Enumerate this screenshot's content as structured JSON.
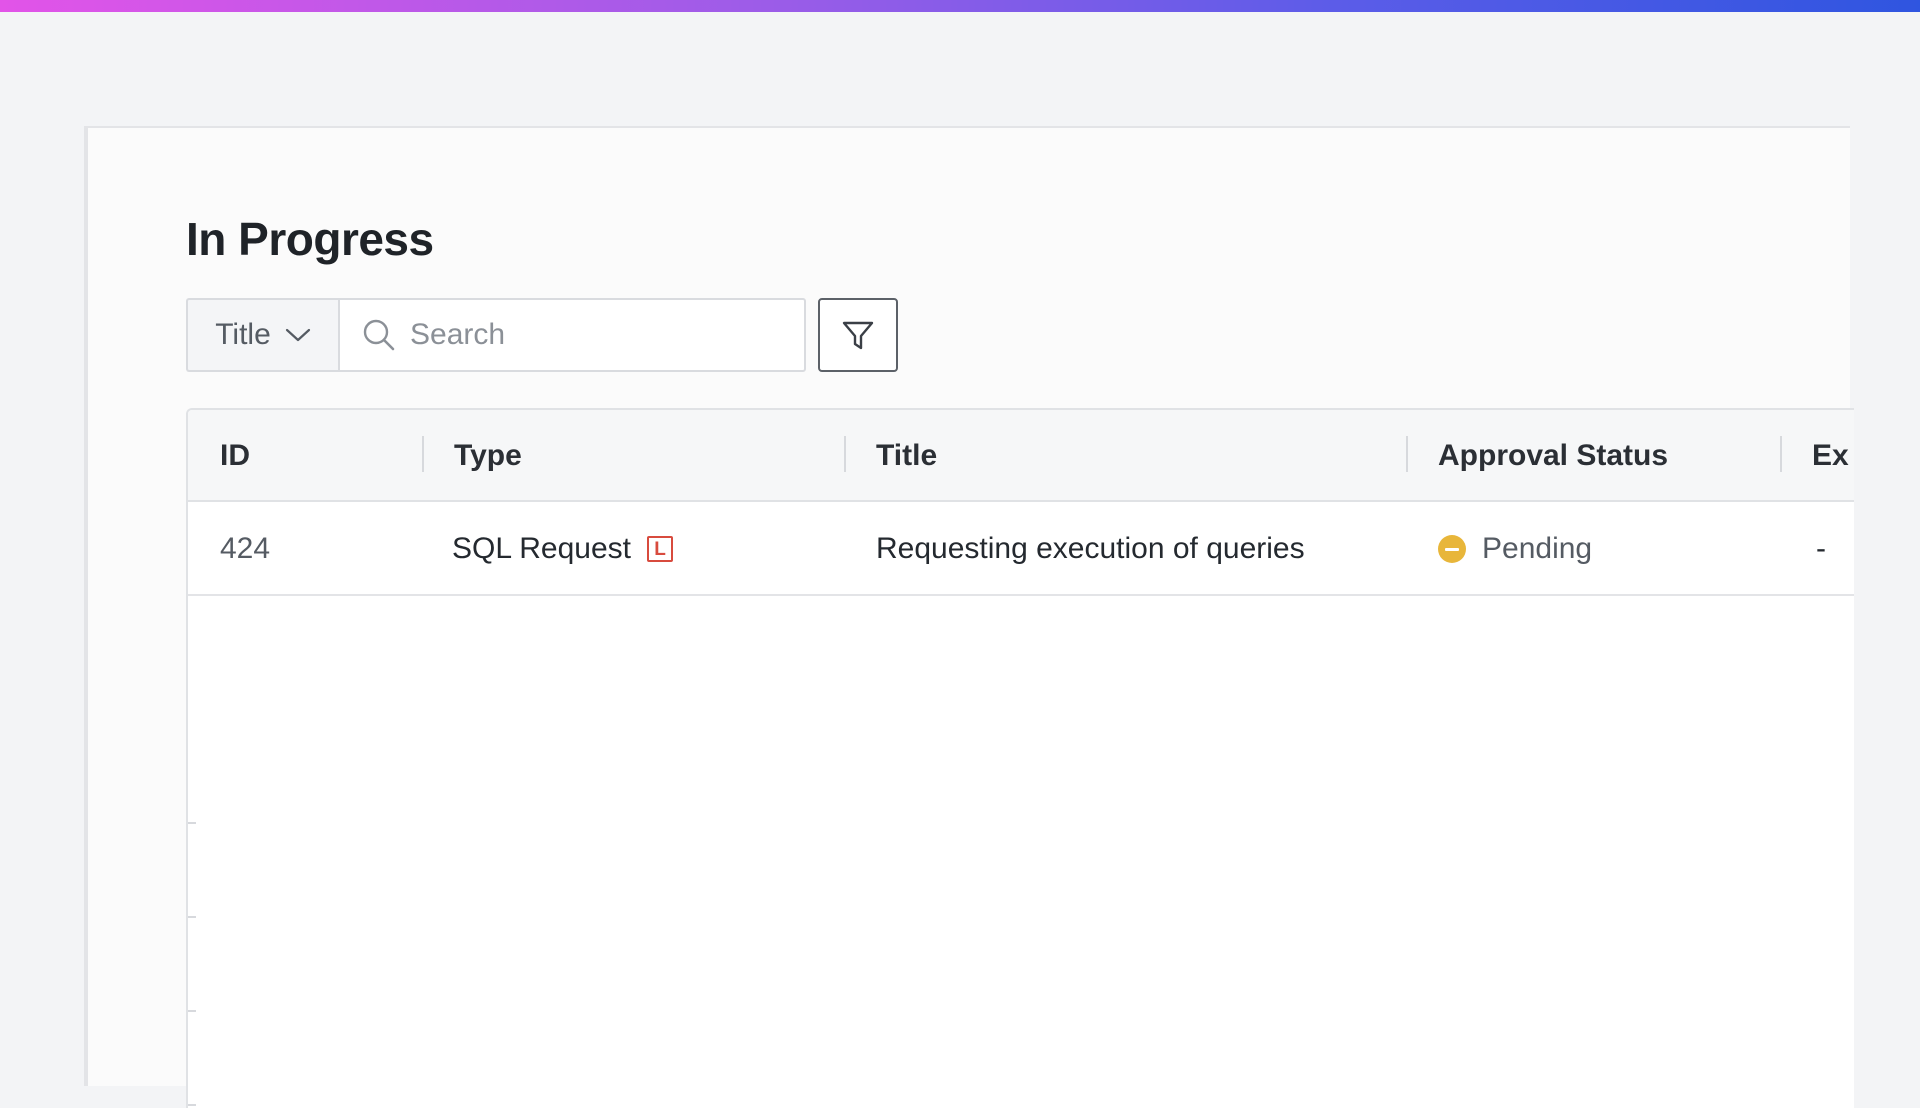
{
  "page": {
    "title": "In Progress"
  },
  "toolbar": {
    "field_select": "Title",
    "search_placeholder": "Search",
    "filter_icon": "filter-icon"
  },
  "table": {
    "columns": [
      "ID",
      "Type",
      "Title",
      "Approval Status",
      "Ex"
    ],
    "rows": [
      {
        "id": "424",
        "type": "SQL Request",
        "type_badge": "L",
        "title": "Requesting execution of queries",
        "approval_status": "Pending",
        "extra": "-"
      }
    ]
  },
  "colors": {
    "accent_gradient_start": "#e254e8",
    "accent_gradient_end": "#2f55e0",
    "pending": "#e8b63a",
    "badge": "#d84b3e"
  }
}
